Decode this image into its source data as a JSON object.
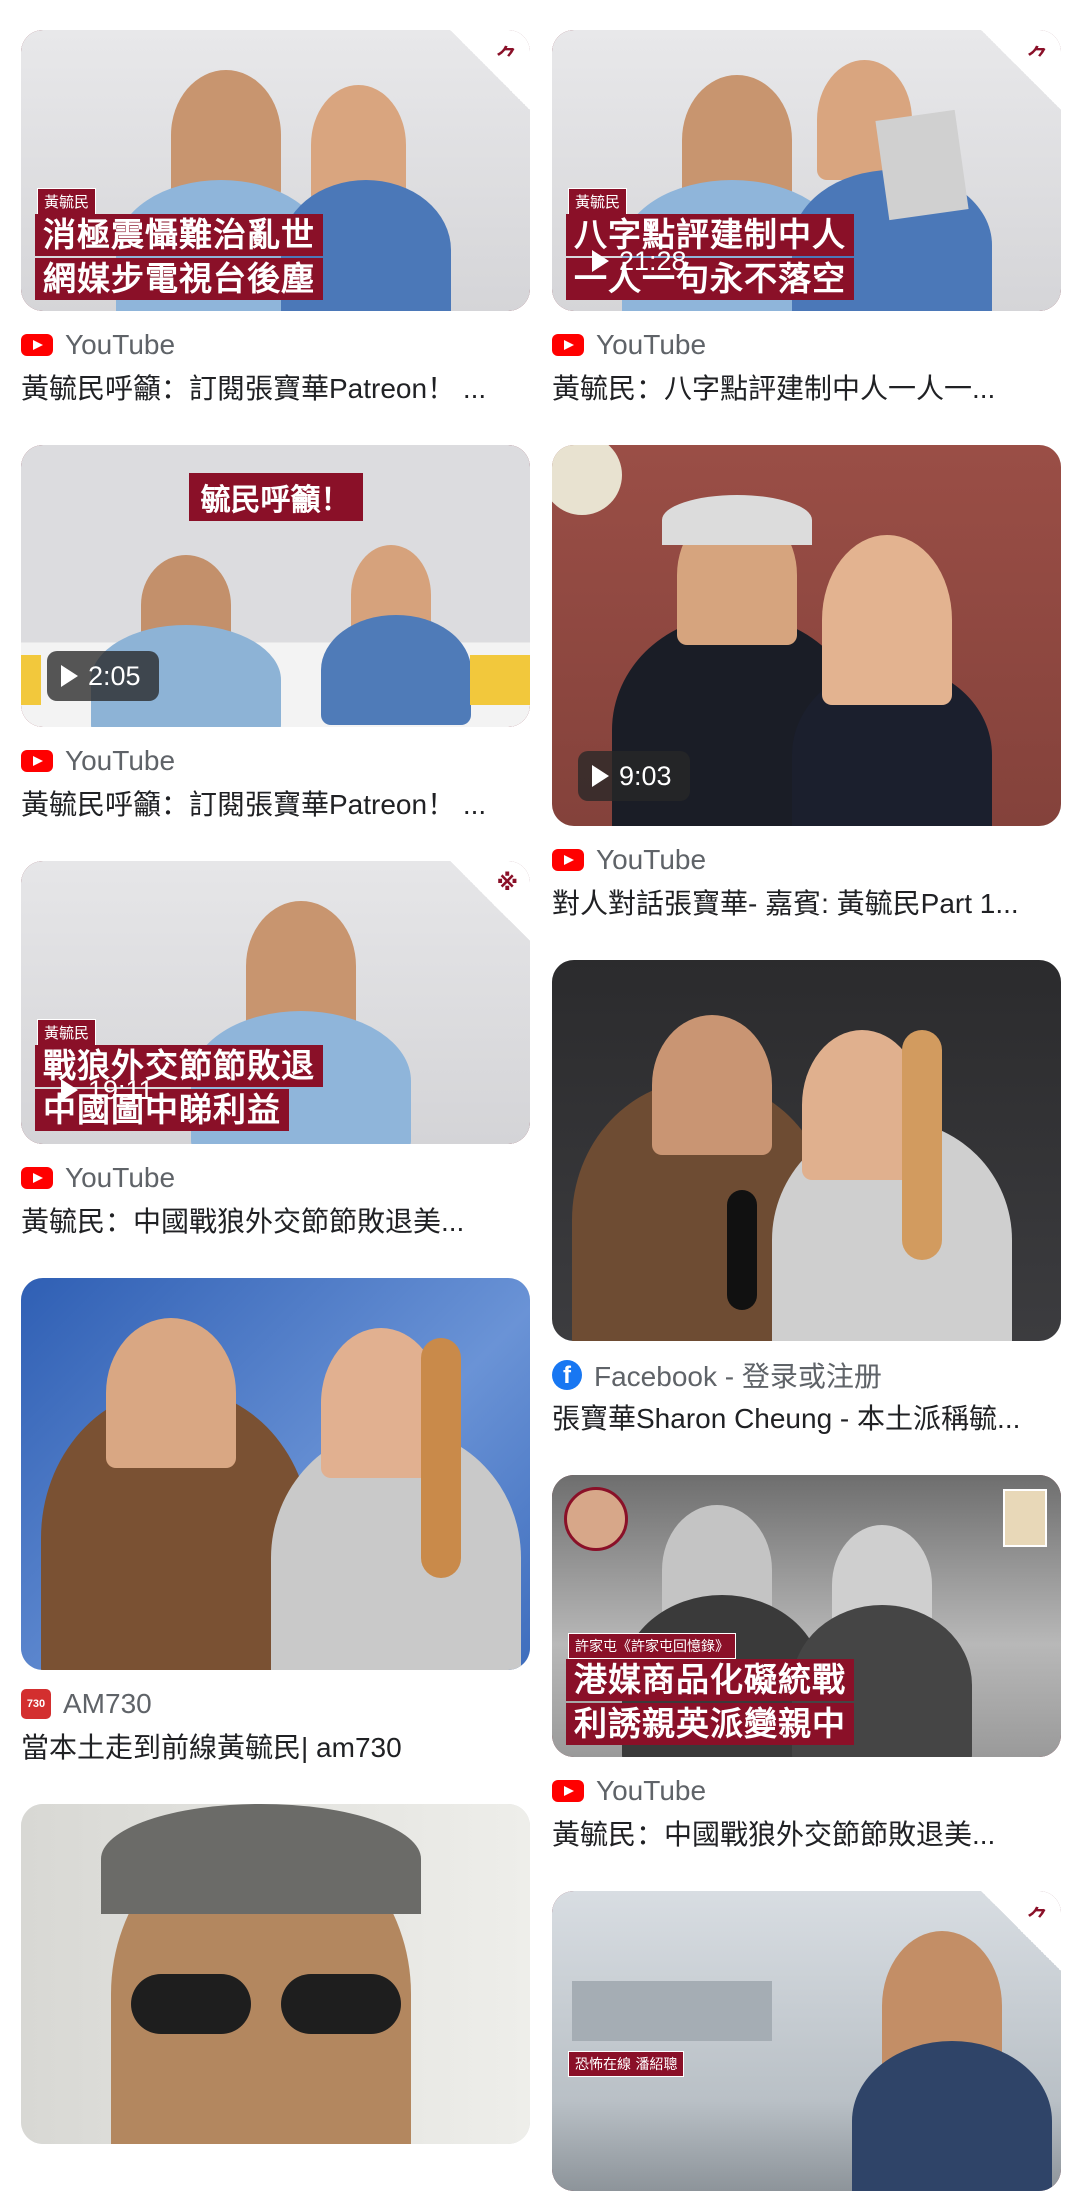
{
  "results": {
    "left": [
      {
        "source": "YouTube",
        "title": "黃毓民呼籲：訂閱張寶華Patreon！ ...",
        "duration": "",
        "tag": "黃毓民",
        "banner_lines": [
          "消極震懾難治亂世",
          "網媒步電視台後塵"
        ],
        "corner_glyph": "⺈"
      },
      {
        "source": "YouTube",
        "title": "黃毓民呼籲：訂閱張寶華Patreon！ ...",
        "duration": "2:05",
        "top_banner": "毓民呼籲！"
      },
      {
        "source": "YouTube",
        "title": "黃毓民：中國戰狼外交節節敗退美...",
        "duration": "19:11",
        "tag": "黃毓民",
        "banner_lines": [
          "戰狼外交節節敗退",
          "中國圖中睇利益"
        ],
        "corner_glyph": "※"
      },
      {
        "source": "AM730",
        "title": "當本土走到前線黃毓民| am730",
        "duration": ""
      },
      {
        "source": "",
        "title": "",
        "duration": ""
      }
    ],
    "right": [
      {
        "source": "YouTube",
        "title": "黃毓民：八字點評建制中人一人一...",
        "duration": "21:28",
        "tag": "黃毓民",
        "banner_lines": [
          "八字點評建制中人",
          "一人一句永不落空"
        ],
        "corner_glyph": "⺈"
      },
      {
        "source": "YouTube",
        "title": "對人對話張寶華- 嘉賓: 黃毓民Part 1...",
        "duration": "9:03"
      },
      {
        "source": "Facebook - 登录或注册",
        "title": "張寶華Sharon Cheung - 本土派稱毓...",
        "duration": ""
      },
      {
        "source": "YouTube",
        "title": "黃毓民：中國戰狼外交節節敗退美...",
        "duration": "",
        "tag": "許家屯《許家屯回憶錄》",
        "banner_lines": [
          "港媒商品化礙統戰",
          "利誘親英派變親中"
        ]
      },
      {
        "source": "",
        "title": "",
        "duration": "",
        "tag": "恐怖在線 潘紹聰",
        "corner_glyph": "⺈"
      }
    ]
  },
  "colors": {
    "youtube_red": "#ff0000",
    "facebook_blue": "#1877f2",
    "banner_maroon": "#8a1028",
    "source_gray": "#5f6368",
    "title_dark": "#202124"
  }
}
